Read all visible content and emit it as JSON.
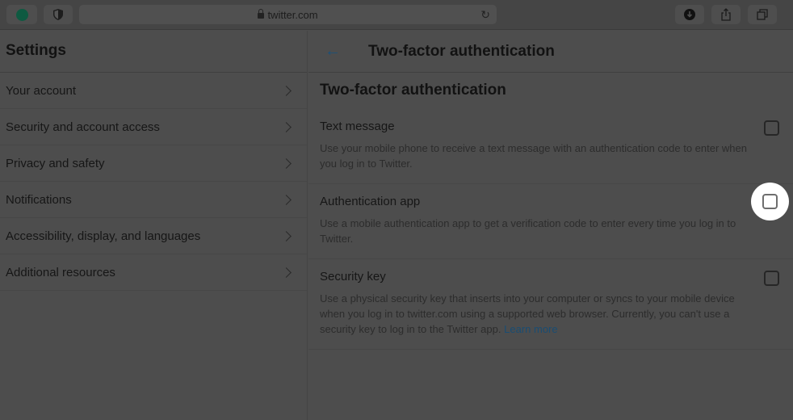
{
  "browser": {
    "url": "twitter.com",
    "icons": {
      "grammarly": "grammarly-icon",
      "shield": "privacy-shield-icon",
      "lock": "lock-icon",
      "reload": "reload-icon",
      "download": "download-icon",
      "share": "share-icon",
      "tabs": "tabs-overview-icon"
    }
  },
  "sidebar": {
    "title": "Settings",
    "items": [
      {
        "label": "Your account"
      },
      {
        "label": "Security and account access"
      },
      {
        "label": "Privacy and safety"
      },
      {
        "label": "Notifications"
      },
      {
        "label": "Accessibility, display, and languages"
      },
      {
        "label": "Additional resources"
      }
    ]
  },
  "main": {
    "back_icon": "←",
    "header_title": "Two-factor authentication",
    "section_title": "Two-factor authentication",
    "options": [
      {
        "label": "Text message",
        "description": "Use your mobile phone to receive a text message with an authentication code to enter when you log in to Twitter.",
        "checked": false
      },
      {
        "label": "Authentication app",
        "description": "Use a mobile authentication app to get a verification code to enter every time you log in to Twitter.",
        "checked": false,
        "highlighted": true
      },
      {
        "label": "Security key",
        "description": "Use a physical security key that inserts into your computer or syncs to your mobile device when you log in to twitter.com using a supported web browser. Currently, you can't use a security key to log in to the Twitter app.",
        "link": "Learn more",
        "checked": false
      }
    ]
  },
  "colors": {
    "accent": "#1d9bf0",
    "highlight": "#ffffff",
    "grammarly": "#15c39a"
  }
}
